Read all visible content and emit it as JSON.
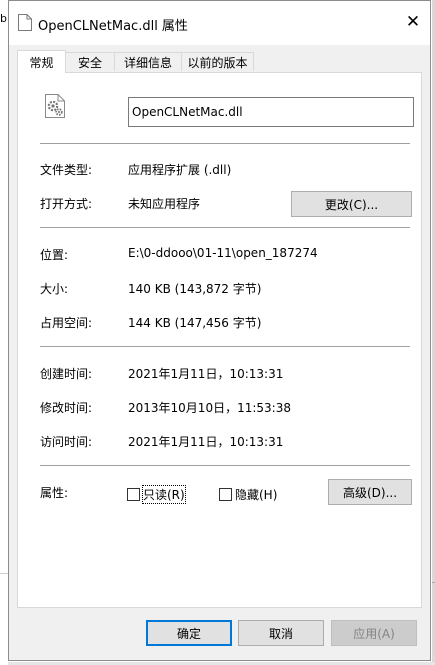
{
  "window": {
    "title": "OpenCLNetMac.dll 属性",
    "close_glyph": "✕"
  },
  "background": {
    "left_char": "b"
  },
  "tabs": [
    {
      "label": "常规",
      "active": true
    },
    {
      "label": "安全",
      "active": false
    },
    {
      "label": "详细信息",
      "active": false
    },
    {
      "label": "以前的版本",
      "active": false
    }
  ],
  "general": {
    "file_icon": "gear-file-icon",
    "file_name": "OpenCLNetMac.dll",
    "type_label": "文件类型:",
    "type_value": "应用程序扩展 (.dll)",
    "opens_with_label": "打开方式:",
    "opens_with_value": "未知应用程序",
    "change_button": "更改(C)...",
    "location_label": "位置:",
    "location_value": "E:\\0-ddooo\\01-11\\open_187274",
    "size_label": "大小:",
    "size_value": "140 KB (143,872 字节)",
    "size_on_disk_label": "占用空间:",
    "size_on_disk_value": "144 KB (147,456 字节)",
    "created_label": "创建时间:",
    "created_value": "2021年1月11日，10:13:31",
    "modified_label": "修改时间:",
    "modified_value": "2013年10月10日，11:53:38",
    "accessed_label": "访问时间:",
    "accessed_value": "2021年1月11日，10:13:31",
    "attributes_label": "属性:",
    "readonly_label": "只读(R)",
    "readonly_checked": false,
    "hidden_label": "隐藏(H)",
    "hidden_checked": false,
    "advanced_button": "高级(D)..."
  },
  "footer": {
    "ok": "确定",
    "cancel": "取消",
    "apply": "应用(A)"
  },
  "colors": {
    "dialog_bg": "#f0f0f0",
    "panel_bg": "#ffffff",
    "focus_border": "#0078d7",
    "button_bg": "#e1e1e1",
    "disabled_text": "#838383"
  }
}
